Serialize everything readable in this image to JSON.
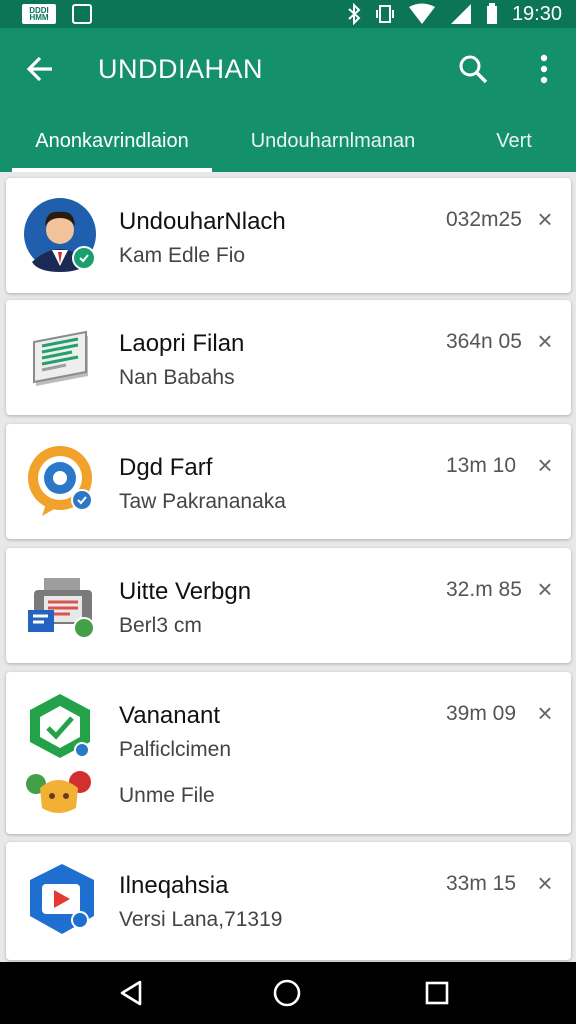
{
  "status_bar": {
    "time": "19:30",
    "left_icons": [
      "notification-app-icon",
      "notification-square-icon"
    ],
    "right_icons": [
      "bluetooth-icon",
      "vibrate-icon",
      "wifi-icon",
      "signal-icon",
      "battery-icon"
    ],
    "mini_label": "DDDI HMM"
  },
  "app_bar": {
    "title": "UNDDIAHAN",
    "back_icon": "arrow-back-icon",
    "search_icon": "search-icon",
    "more_icon": "more-vert-icon"
  },
  "tabs": [
    {
      "label": "Anonkavrindlaion",
      "active": true
    },
    {
      "label": "Undouharnlmanan",
      "active": false
    },
    {
      "label": "Vert",
      "active": false
    }
  ],
  "items": [
    {
      "title": "UndouharNlach",
      "subtitle": "Kam Edle Fio",
      "meta": "032m25",
      "icon": "person-avatar-icon"
    },
    {
      "title": "Laopri Filan",
      "subtitle": "Nan Babahs",
      "meta": "364n 05",
      "icon": "document-stack-icon"
    },
    {
      "title": "Dgd Farf",
      "subtitle": "Taw Pakrananaka",
      "meta": "13m 10",
      "icon": "settings-badge-icon"
    },
    {
      "title": "Uitte Verbgn",
      "subtitle": "Berl3 cm",
      "meta": "32.m 85",
      "icon": "printer-device-icon"
    },
    {
      "title": "Vananant",
      "subtitle": "Palficlcimen",
      "subtitle2": "Unme File",
      "meta": "39m 09",
      "icon": "hexagon-emoji-icon"
    },
    {
      "title": "Ilneqahsia",
      "subtitle": "Versi Lana,71319",
      "meta": "33m 15",
      "icon": "video-play-icon"
    }
  ],
  "close_glyph": "×",
  "nav_bar": {
    "icons": [
      "nav-back-icon",
      "nav-home-icon",
      "nav-recents-icon"
    ]
  },
  "colors": {
    "primary": "#14906b",
    "status": "#0c7556",
    "background": "#e8e8e8"
  }
}
